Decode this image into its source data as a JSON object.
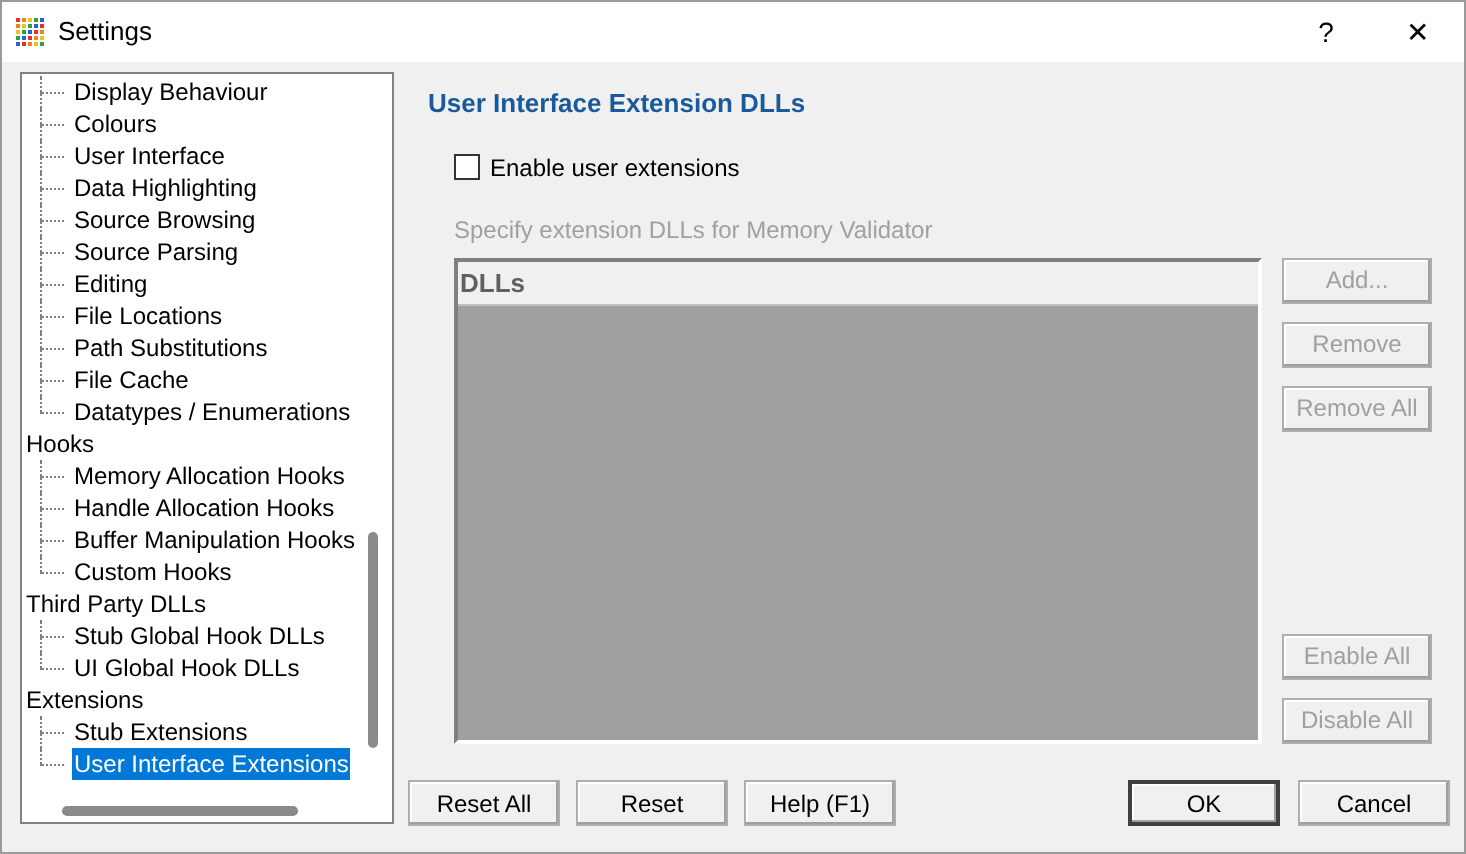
{
  "window": {
    "title": "Settings",
    "help": "?",
    "close": "✕"
  },
  "tree": [
    {
      "children": [
        {
          "label": "Display Behaviour",
          "selected": false
        },
        {
          "label": "Colours",
          "selected": false
        },
        {
          "label": "User Interface",
          "selected": false
        },
        {
          "label": "Data Highlighting",
          "selected": false
        },
        {
          "label": "Source Browsing",
          "selected": false
        },
        {
          "label": "Source Parsing",
          "selected": false
        },
        {
          "label": "Editing",
          "selected": false
        },
        {
          "label": "File Locations",
          "selected": false
        },
        {
          "label": "Path Substitutions",
          "selected": false
        },
        {
          "label": "File Cache",
          "selected": false
        },
        {
          "label": "Datatypes / Enumerations",
          "selected": false
        }
      ]
    },
    {
      "label": "Hooks",
      "selected": false,
      "children": [
        {
          "label": "Memory Allocation Hooks",
          "selected": false
        },
        {
          "label": "Handle Allocation Hooks",
          "selected": false
        },
        {
          "label": "Buffer Manipulation Hooks",
          "selected": false
        },
        {
          "label": "Custom Hooks",
          "selected": false
        }
      ]
    },
    {
      "label": "Third Party DLLs",
      "selected": false,
      "children": [
        {
          "label": "Stub Global Hook DLLs",
          "selected": false
        },
        {
          "label": "UI Global Hook DLLs",
          "selected": false
        }
      ]
    },
    {
      "label": "Extensions",
      "selected": false,
      "children": [
        {
          "label": "Stub Extensions",
          "selected": false
        },
        {
          "label": "User Interface Extensions",
          "selected": true
        }
      ]
    }
  ],
  "panel": {
    "heading": "User Interface Extension DLLs",
    "checkbox": {
      "label": "Enable user extensions",
      "checked": false
    },
    "hint": "Specify extension DLLs for Memory Validator",
    "list": {
      "columns": [
        "DLLs"
      ]
    },
    "side_buttons": [
      {
        "label": "Add...",
        "disabled": true
      },
      {
        "label": "Remove",
        "disabled": true
      },
      {
        "label": "Remove All",
        "disabled": true
      }
    ],
    "lower_buttons": [
      {
        "label": "Enable All",
        "disabled": true
      },
      {
        "label": "Disable All",
        "disabled": true
      }
    ]
  },
  "buttons": [
    {
      "label": "Reset All",
      "default": false
    },
    {
      "label": "Reset",
      "default": false
    },
    {
      "label": "Help (F1)",
      "default": false
    }
  ],
  "dialog_buttons": [
    {
      "label": "OK",
      "default": true
    },
    {
      "label": "Cancel",
      "default": false
    }
  ]
}
